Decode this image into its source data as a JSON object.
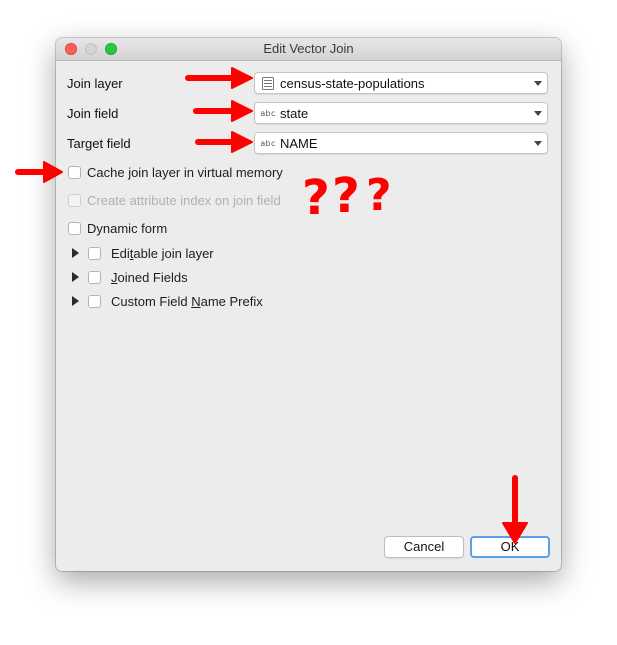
{
  "window": {
    "title": "Edit Vector Join"
  },
  "fields": {
    "join_layer": {
      "label": "Join layer",
      "value": "census-state-populations",
      "icon": "layer-table-icon"
    },
    "join_field": {
      "label": "Join field",
      "value": "state",
      "icon_text": "abc"
    },
    "target_field": {
      "label": "Target field",
      "value": "NAME",
      "icon_text": "abc"
    }
  },
  "options": {
    "cache": {
      "label": "Cache join layer in virtual memory",
      "checked": false
    },
    "index": {
      "label": "Create attribute index on join field",
      "checked": false,
      "enabled": false
    },
    "dynamic": {
      "label": "Dynamic form",
      "checked": false
    }
  },
  "groups": [
    {
      "label_pre": "Edi",
      "label_mnemonic": "t",
      "label_post": "able join layer"
    },
    {
      "label_pre": "",
      "label_mnemonic": "J",
      "label_post": "oined Fields"
    },
    {
      "label_pre": "Custom Field ",
      "label_mnemonic": "N",
      "label_post": "ame Prefix"
    }
  ],
  "buttons": {
    "cancel": "Cancel",
    "ok": "OK"
  },
  "annotations": {
    "color": "#ff0000",
    "question_marks": [
      "?",
      "?",
      "?"
    ]
  }
}
